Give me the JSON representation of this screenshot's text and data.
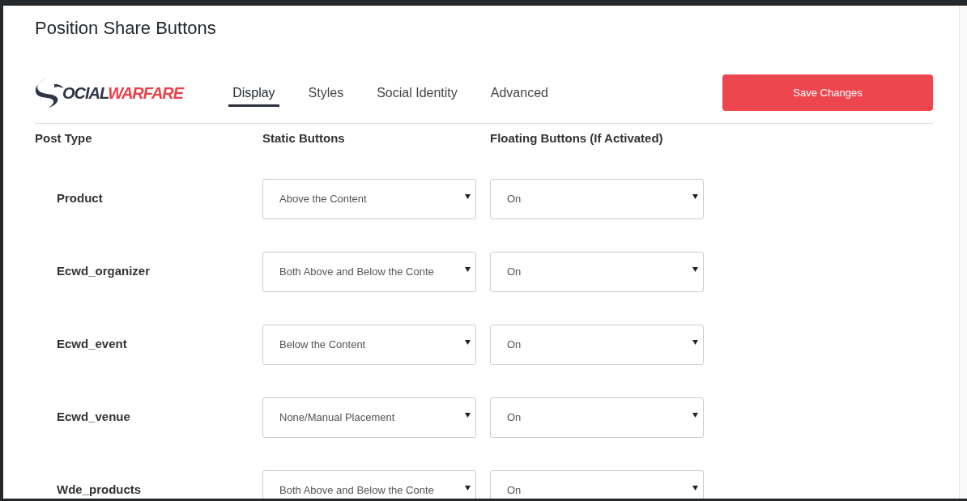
{
  "page_title": "Position Share Buttons",
  "logo": {
    "dark_text": "OCIAL",
    "red_text": "WARFARE"
  },
  "tabs": [
    {
      "label": "Display",
      "selected": true
    },
    {
      "label": "Styles",
      "selected": false
    },
    {
      "label": "Social Identity",
      "selected": false
    },
    {
      "label": "Advanced",
      "selected": false
    }
  ],
  "save_button": "Save Changes",
  "columns": [
    "Post Type",
    "Static Buttons",
    "Floating Buttons (If Activated)"
  ],
  "rows": [
    {
      "post_type": "Product",
      "static_buttons": "Above the Content",
      "floating_buttons": "On"
    },
    {
      "post_type": "Ecwd_organizer",
      "static_buttons": "Both Above and Below the Conte",
      "floating_buttons": "On"
    },
    {
      "post_type": "Ecwd_event",
      "static_buttons": "Below the Content",
      "floating_buttons": "On"
    },
    {
      "post_type": "Ecwd_venue",
      "static_buttons": "None/Manual Placement",
      "floating_buttons": "On"
    },
    {
      "post_type": "Wde_products",
      "static_buttons": "Both Above and Below the Conte",
      "floating_buttons": "On"
    }
  ]
}
